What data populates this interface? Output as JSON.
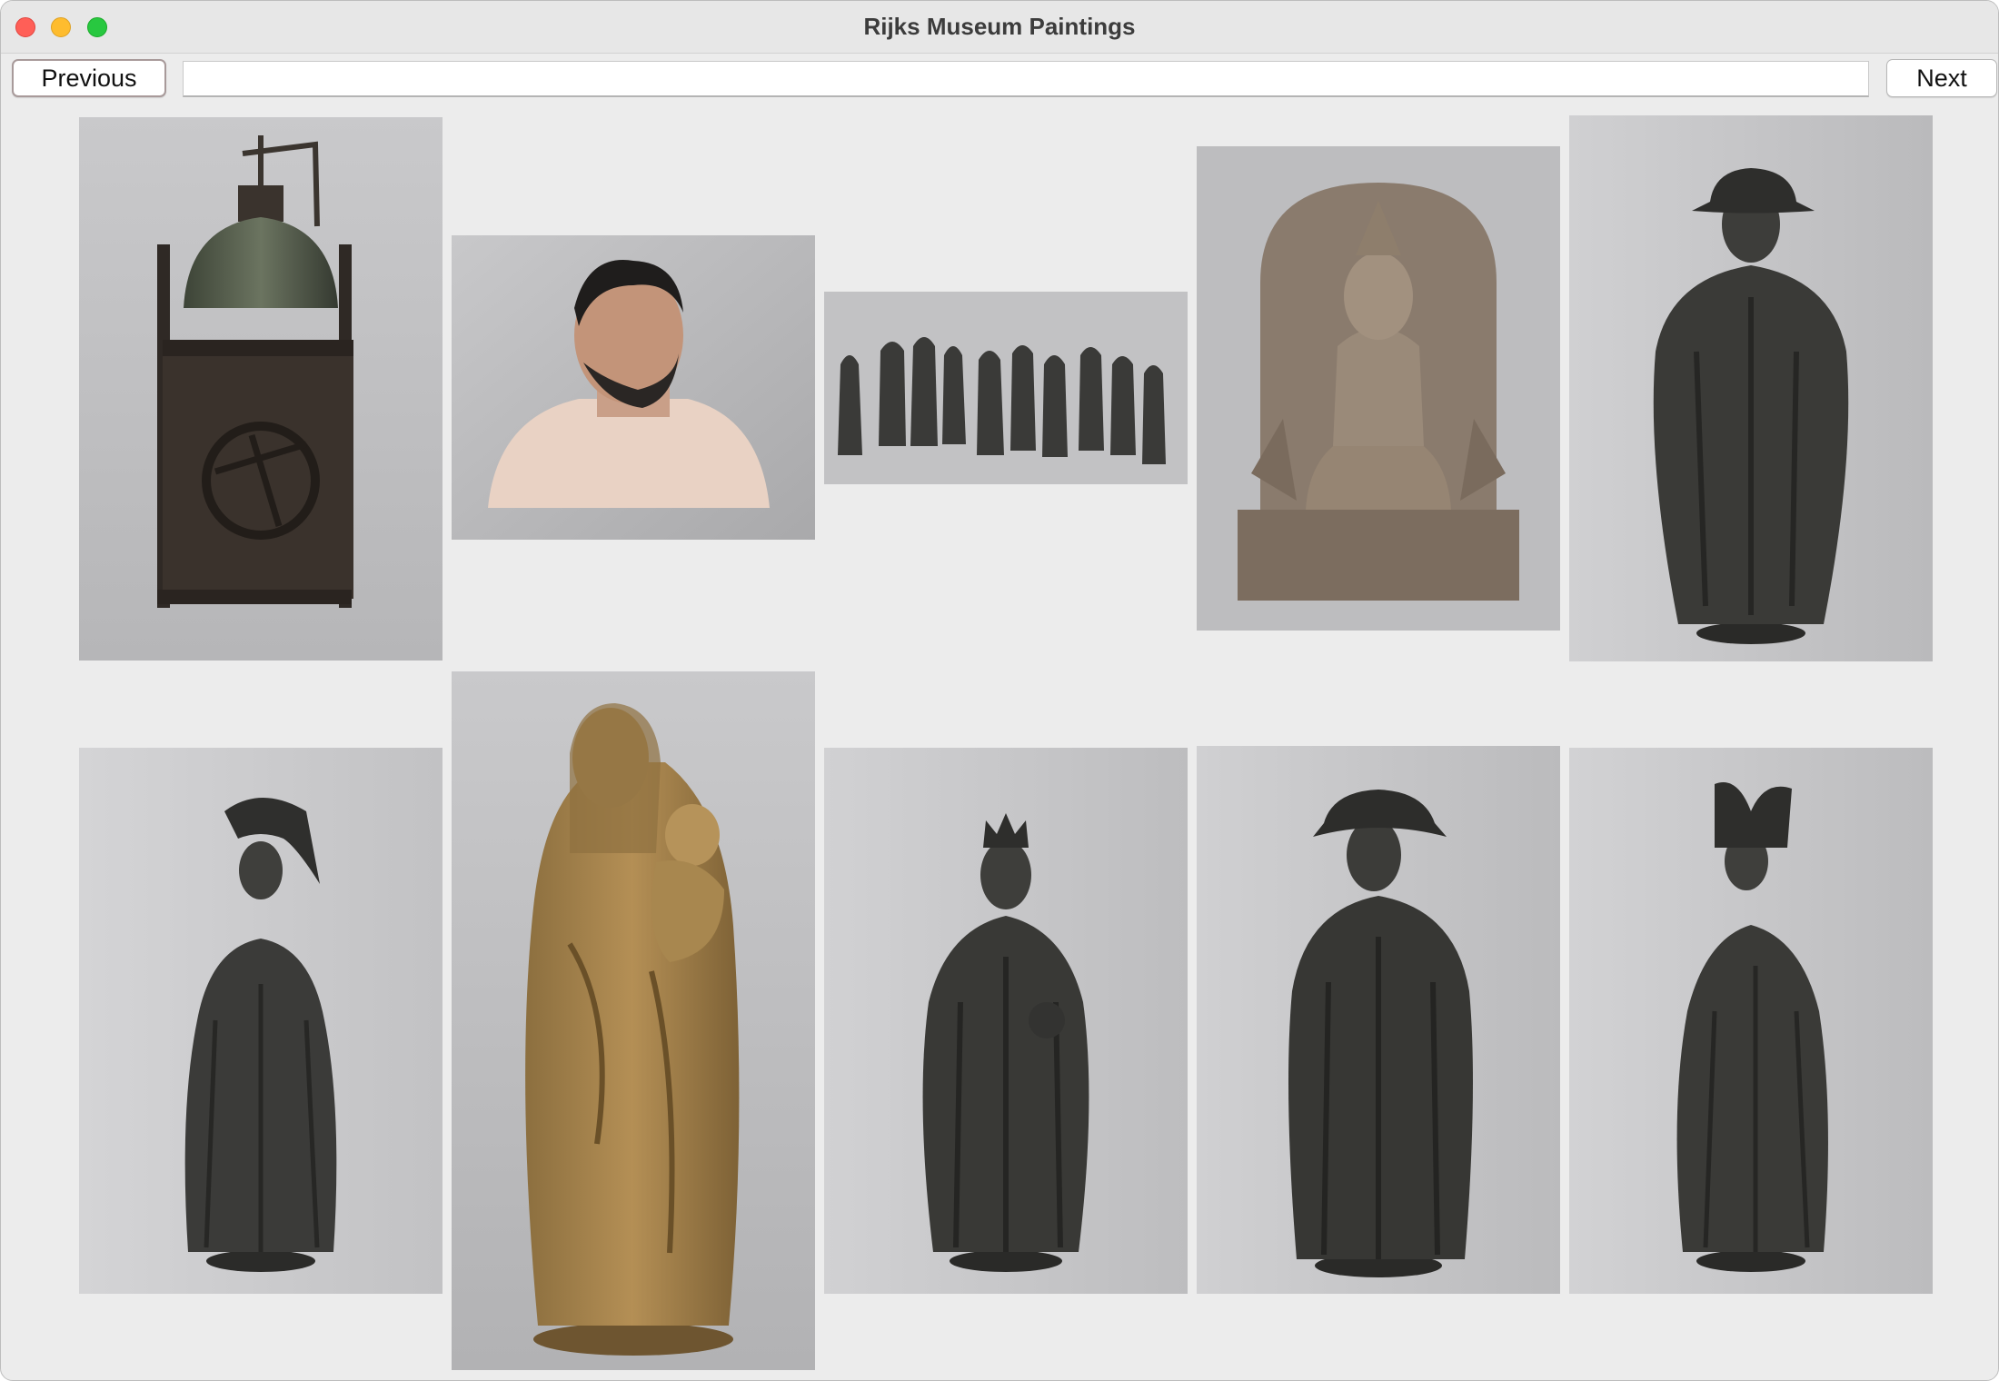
{
  "window": {
    "title": "Rijks Museum Paintings"
  },
  "toolbar": {
    "previous_label": "Previous",
    "next_label": "Next",
    "path_value": ""
  },
  "gallery": {
    "images": [
      {
        "subject": "clock-with-bell"
      },
      {
        "subject": "polychrome-male-bust"
      },
      {
        "subject": "group-of-bronze-figures"
      },
      {
        "subject": "seated-stone-deity"
      },
      {
        "subject": "bronze-man-with-hat"
      },
      {
        "subject": "bronze-woman-with-headdress"
      },
      {
        "subject": "virgin-and-child"
      },
      {
        "subject": "bronze-crowned-king"
      },
      {
        "subject": "bronze-man-with-wide-hat"
      },
      {
        "subject": "bronze-woman-with-horned-headdress"
      }
    ]
  }
}
